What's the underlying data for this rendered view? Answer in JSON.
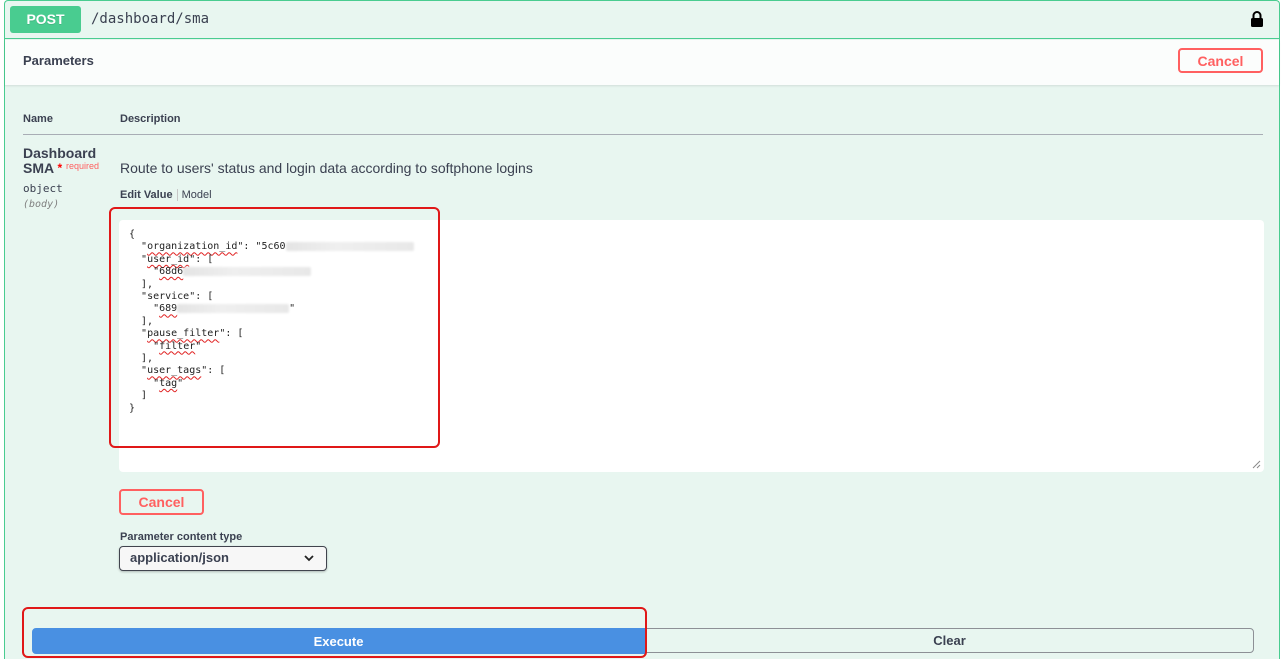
{
  "operation": {
    "method": "POST",
    "path": "/dashboard/sma"
  },
  "parameters": {
    "title": "Parameters",
    "cancel_label": "Cancel",
    "col_name": "Name",
    "col_description": "Description"
  },
  "param": {
    "name_line1": "Dashboard",
    "name_line2": "SMA",
    "required_star": "*",
    "required_text": "required",
    "type": "object",
    "in": "(body)",
    "description": "Route to users' status and login data according to softphone logins"
  },
  "tabs": {
    "edit_value": "Edit Value",
    "model": "Model"
  },
  "body_json": {
    "open": "{",
    "org_key": "organization_id",
    "org_value_prefix": "5c60",
    "user_id_key": "user_id",
    "user_id_value_prefix": "68d6",
    "service_key": "service",
    "service_value_prefix": "689",
    "pause_filter_key": "pause_filter",
    "pause_filter_value": "filter",
    "user_tags_key": "user_tags",
    "user_tags_value": "tag",
    "close": "}"
  },
  "editor_cancel_label": "Cancel",
  "content_type": {
    "label": "Parameter content type",
    "selected": "application/json"
  },
  "actions": {
    "execute": "Execute",
    "clear": "Clear"
  },
  "colors": {
    "post_green": "#49cc90",
    "post_bg": "#e8f6f0",
    "cancel_red": "#ff6060",
    "execute_blue": "#4990e2",
    "highlight_red": "#e01818"
  }
}
